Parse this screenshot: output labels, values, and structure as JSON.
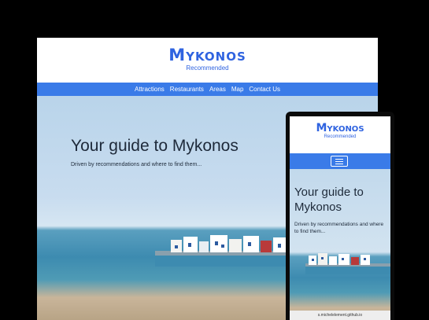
{
  "desktop": {
    "logo": "Mykonos",
    "tagline": "Recommended",
    "nav": [
      "Attractions",
      "Restaurants",
      "Areas",
      "Map",
      "Contact Us"
    ],
    "hero_title": "Your guide to Mykonos",
    "hero_subtitle": "Driven by recommendations and where to find them..."
  },
  "mobile": {
    "logo": "Mykonos",
    "tagline": "Recommended",
    "hero_title": "Your guide to Mykonos",
    "hero_subtitle": "Driven by recommendations and where to find them...",
    "url": "s.michelelement.github.io"
  },
  "icons": {
    "menu": "hamburger-icon"
  },
  "colors": {
    "brand": "#2f63e0",
    "nav": "#3a7be8",
    "text": "#1e2a3a"
  }
}
